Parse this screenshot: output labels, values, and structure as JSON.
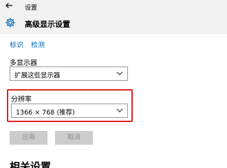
{
  "window": {
    "title": "设置"
  },
  "header": {
    "title": "高级显示设置",
    "icon": "gear-icon"
  },
  "links": {
    "identify": "标识",
    "detect": "检测"
  },
  "multi_display": {
    "label": "多显示器",
    "value": "扩展这些显示器"
  },
  "resolution": {
    "label": "分辨率",
    "value": "1366 × 768 (推荐)",
    "highlight_color": "#e02020"
  },
  "buttons": {
    "apply": "应用",
    "cancel": "取消"
  },
  "related": {
    "heading": "相关设置"
  },
  "colors": {
    "accent": "#0067b8",
    "header_bg": "#f2f2f2",
    "disabled_bg": "#cccccc"
  }
}
